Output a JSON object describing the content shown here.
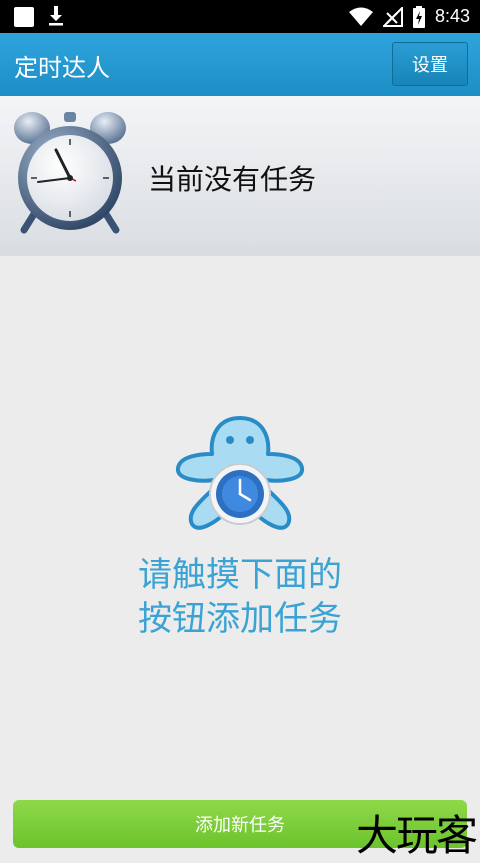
{
  "status_bar": {
    "time": "8:43"
  },
  "app_bar": {
    "title": "定时达人",
    "settings_label": "设置"
  },
  "task_panel": {
    "empty_text": "当前没有任务"
  },
  "hint": {
    "line1": "请触摸下面的",
    "line2": "按钮添加任务"
  },
  "add_button": {
    "label": "添加新任务"
  },
  "watermark": {
    "text": "大玩客"
  },
  "icons": [
    "image-icon",
    "download-icon",
    "wifi-icon",
    "signal-icon",
    "battery-charging-icon",
    "alarm-clock-icon",
    "mascot-clock-icon"
  ],
  "colors": {
    "app_bar": "#2fa4dc",
    "hint_text": "#3aa3d3",
    "add_button": "#7ccc3a"
  }
}
